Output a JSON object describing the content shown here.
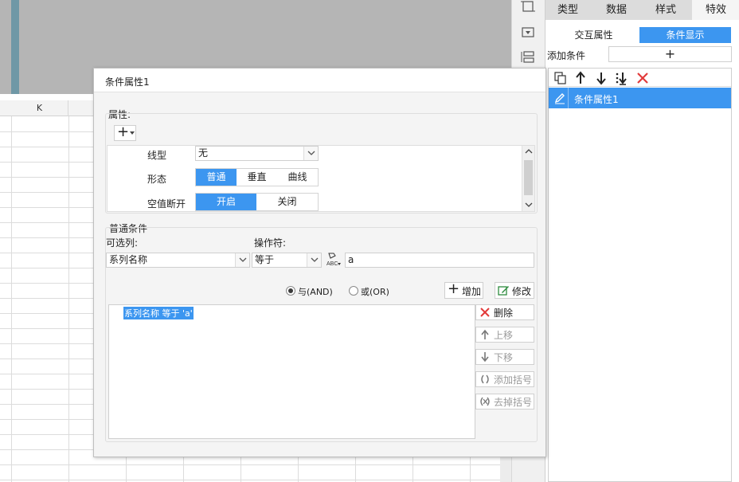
{
  "sheet": {
    "column_header": "K"
  },
  "right_panel": {
    "tabs": [
      "类型",
      "数据",
      "样式",
      "特效"
    ],
    "segments": [
      "交互属性",
      "条件显示"
    ],
    "add_condition_label": "添加条件",
    "add_condition_plus": "+",
    "conditions": [
      "条件属性1"
    ]
  },
  "dialog": {
    "title": "条件属性1",
    "properties_group_label": "属性:",
    "add_prop_plus": "+",
    "props": {
      "line_type_label": "线型",
      "line_type_value": "无",
      "shape_label": "形态",
      "shape_options": [
        "普通",
        "垂直",
        "曲线"
      ],
      "null_break_label": "空值断开",
      "null_break_options": [
        "开启",
        "关闭"
      ]
    },
    "condition_group_label": "普通条件",
    "column_label": "可选列:",
    "column_value": "系列名称",
    "operator_label": "操作符:",
    "operator_value": "等于",
    "value_text": "a",
    "and_label": "与(AND)",
    "or_label": "或(OR)",
    "add_button": "增加",
    "modify_button": "修改",
    "condition_expression": "系列名称 等于 'a'",
    "side_buttons": {
      "delete": "删除",
      "move_up": "上移",
      "move_down": "下移",
      "add_bracket": "添加括号",
      "remove_bracket": "去掉括号"
    }
  },
  "colors": {
    "accent": "#3c96f0",
    "selected_text_bg": "#3c96f0",
    "delete_red": "#e23b3b"
  }
}
